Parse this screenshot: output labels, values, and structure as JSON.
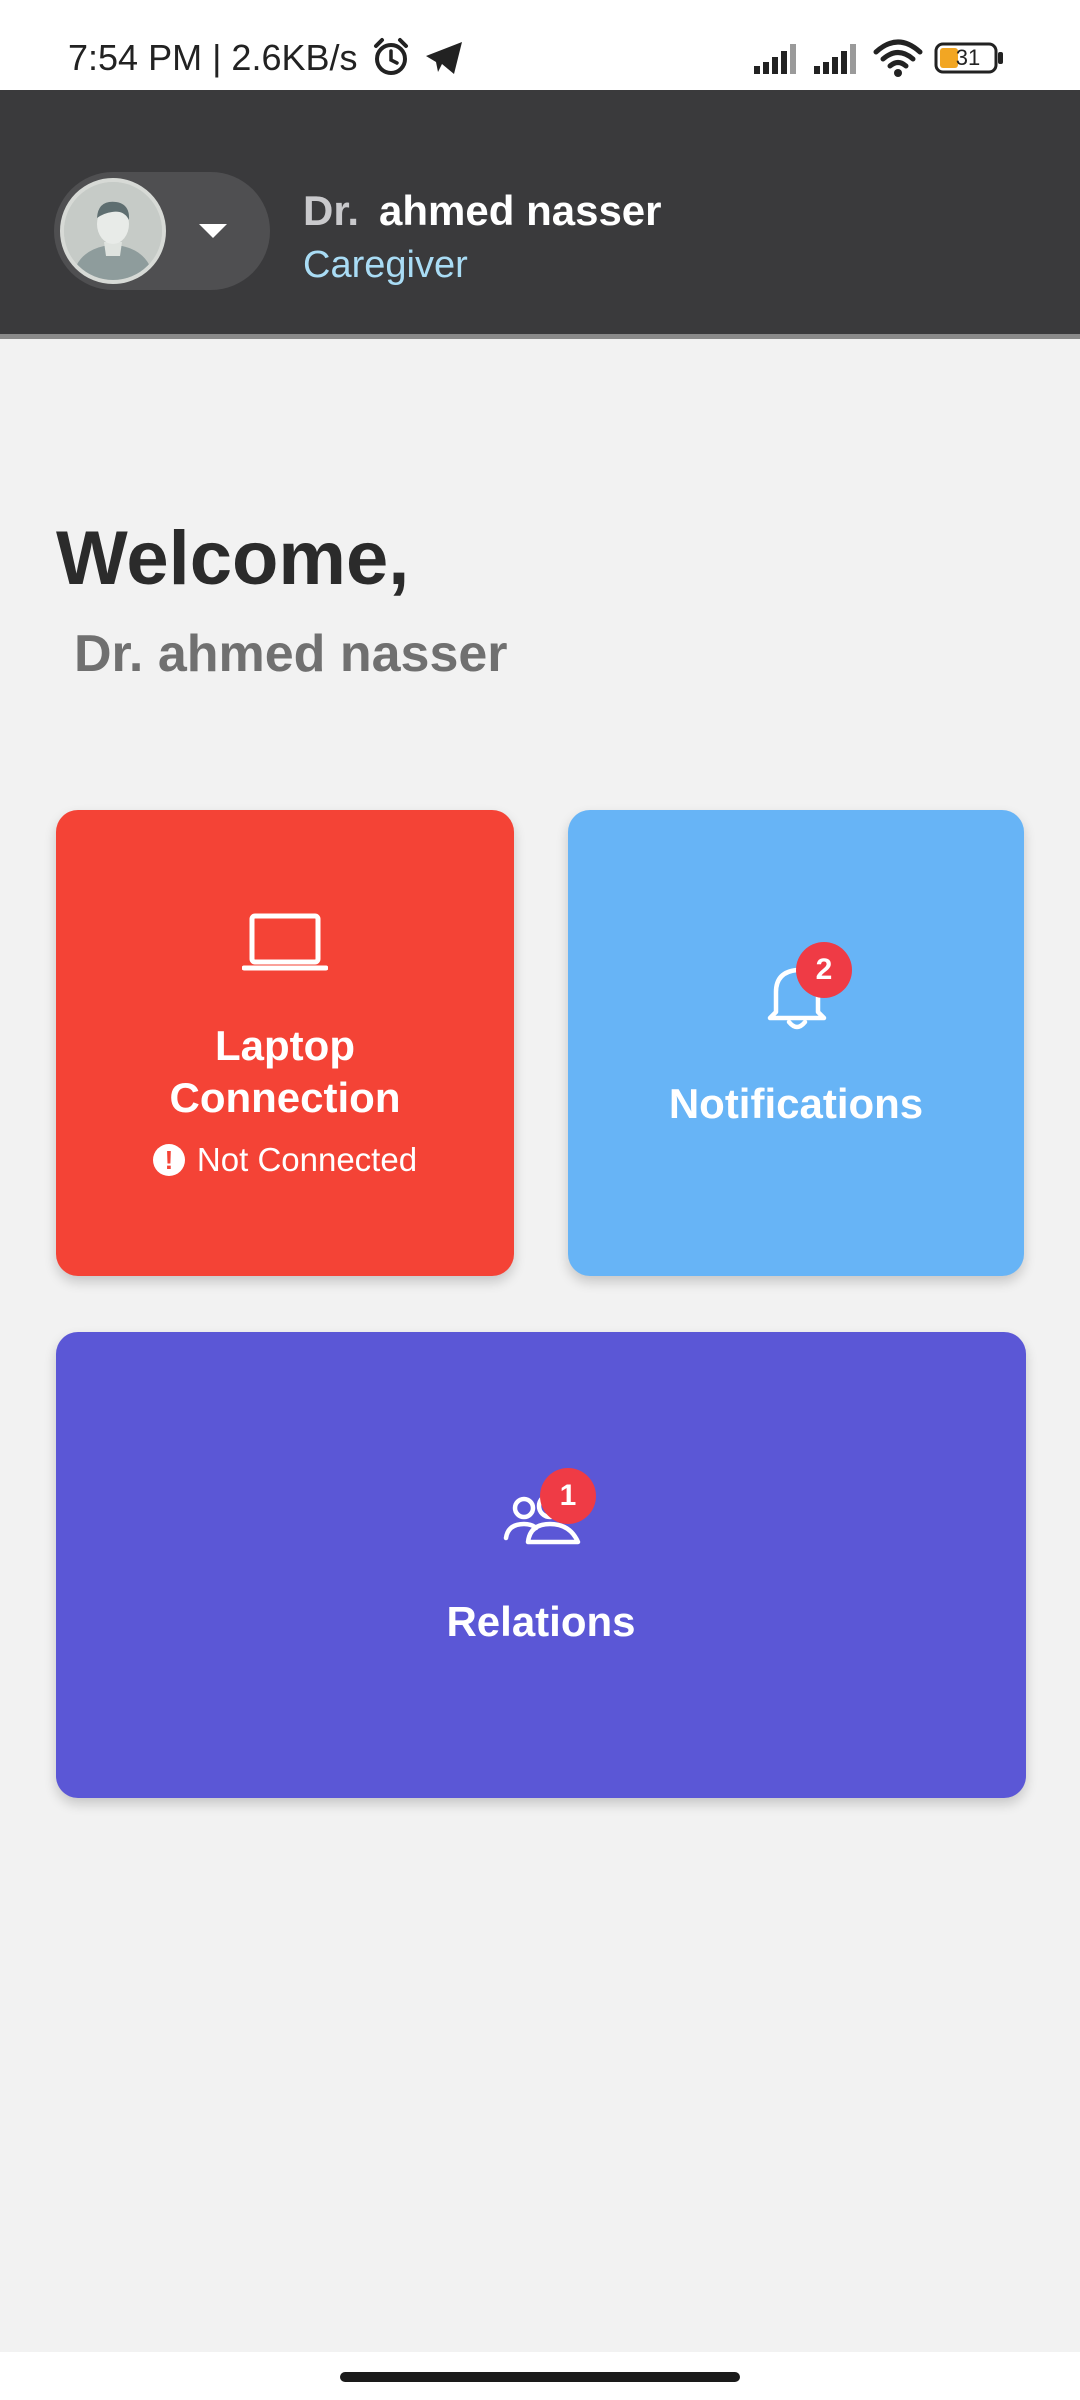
{
  "status_bar": {
    "time": "7:54 PM | 2.6KB/s",
    "battery_level": "31",
    "icons": [
      "alarm-icon",
      "telegram-icon",
      "signal-icon",
      "signal-icon",
      "wifi-icon",
      "battery-icon"
    ]
  },
  "header": {
    "name_prefix": "Dr.",
    "name": "ahmed nasser",
    "role": "Caregiver"
  },
  "welcome": {
    "title": "Welcome,",
    "name": "Dr. ahmed nasser"
  },
  "cards": {
    "laptop": {
      "label": "Laptop\nConnection",
      "label_line1": "Laptop",
      "label_line2": "Connection",
      "status_icon": "!",
      "status": "Not Connected",
      "icon": "laptop-icon",
      "color": "#f44336"
    },
    "notifications": {
      "label": "Notifications",
      "badge": "2",
      "icon": "bell-icon",
      "color": "#67b4f6"
    },
    "relations": {
      "label": "Relations",
      "badge": "1",
      "icon": "users-icon",
      "color": "#5b57d6"
    }
  }
}
